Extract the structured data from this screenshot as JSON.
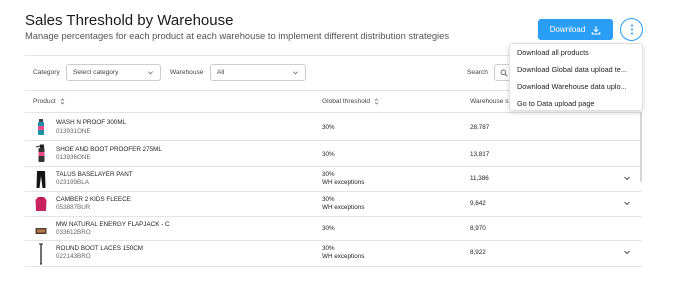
{
  "header": {
    "title": "Sales Threshold by Warehouse",
    "subtitle": "Manage percentages for each product at each warehouse to implement different distribution strategies",
    "download_label": "Download"
  },
  "menu": {
    "items": [
      {
        "label": "Download all products"
      },
      {
        "label": "Download Global data upload te..."
      },
      {
        "label": "Download Warehouse data uplo..."
      },
      {
        "label": "Go to Data upload page"
      }
    ]
  },
  "filters": {
    "category_label": "Category",
    "category_value": "Select category",
    "warehouse_label": "Warehouse",
    "warehouse_value": "All",
    "search_label": "Search"
  },
  "table": {
    "columns": {
      "product": "Product",
      "global": "Global threshold",
      "warehouse": "Warehouse st"
    },
    "rows": [
      {
        "name": "WASH N PROOF 300ML",
        "code": "013931ONE",
        "global": "30%",
        "exceptions": "",
        "stock": "28,787",
        "expandable": false
      },
      {
        "name": "SHOE AND BOOT PROOFER 275ML",
        "code": "013936ONE",
        "global": "30%",
        "exceptions": "",
        "stock": "13,817",
        "expandable": false
      },
      {
        "name": "TALUS BASELAYER PANT",
        "code": "023199BLA",
        "global": "30%",
        "exceptions": "WH exceptions",
        "stock": "11,386",
        "expandable": true
      },
      {
        "name": "CAMBER 2 KIDS FLEECE",
        "code": "053887BUR",
        "global": "30%",
        "exceptions": "WH exceptions",
        "stock": "9,642",
        "expandable": true
      },
      {
        "name": "MW NATURAL ENERGY FLAPJACK - C",
        "code": "033612BRO",
        "global": "30%",
        "exceptions": "",
        "stock": "8,970",
        "expandable": false
      },
      {
        "name": "ROUND BOOT LACES 150CM",
        "code": "022143BRO",
        "global": "30%",
        "exceptions": "WH exceptions",
        "stock": "8,922",
        "expandable": true
      }
    ]
  },
  "colors": {
    "accent": "#2a9df4"
  }
}
